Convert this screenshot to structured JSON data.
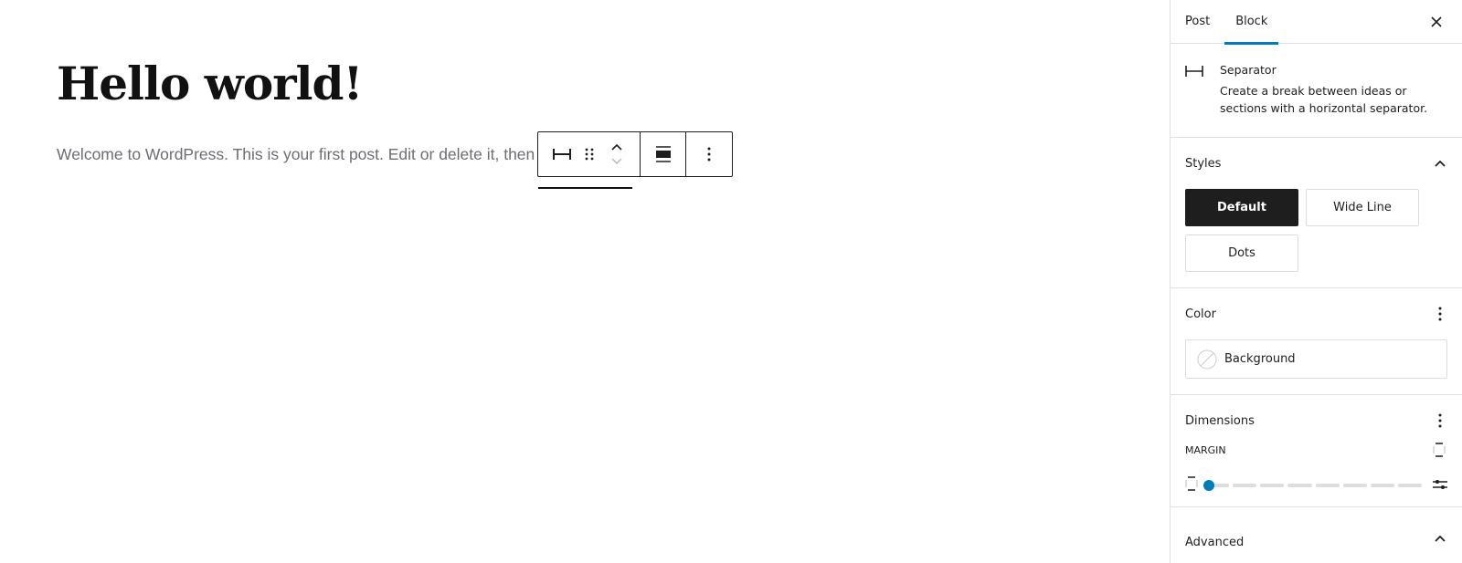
{
  "editor": {
    "title": "Hello world!",
    "body_text": "Welcome to WordPress. This is your first post. Edit or delete it, then start writing!",
    "toolbar": {
      "block_type_icon": "separator-icon",
      "drag_icon": "drag-handle-icon",
      "move_up_icon": "chevron-up-icon",
      "move_down_icon": "chevron-down-icon",
      "align_icon": "align-wide-icon",
      "options_icon": "more-vertical-icon"
    }
  },
  "sidebar": {
    "tabs": [
      {
        "label": "Post",
        "active": false
      },
      {
        "label": "Block",
        "active": true
      }
    ],
    "close_icon": "close-icon",
    "block_card": {
      "icon": "separator-icon",
      "title": "Separator",
      "description": "Create a break between ideas or sections with a horizontal separator."
    },
    "styles_panel": {
      "title": "Styles",
      "expanded": true,
      "options": [
        {
          "label": "Default",
          "active": true
        },
        {
          "label": "Wide Line",
          "active": false
        },
        {
          "label": "Dots",
          "active": false
        }
      ]
    },
    "color_panel": {
      "title": "Color",
      "items": [
        {
          "label": "Background",
          "swatch": "none"
        }
      ]
    },
    "dimensions_panel": {
      "title": "Dimensions",
      "margin_label": "MARGIN",
      "margin_slider": {
        "value_step": 0,
        "steps": 8
      }
    },
    "advanced_panel": {
      "title": "Advanced",
      "expanded": false
    }
  },
  "colors": {
    "accent": "#007cba",
    "text": "#1e1e1e",
    "border": "#e0e0e0",
    "body_text": "#6d6d75"
  }
}
